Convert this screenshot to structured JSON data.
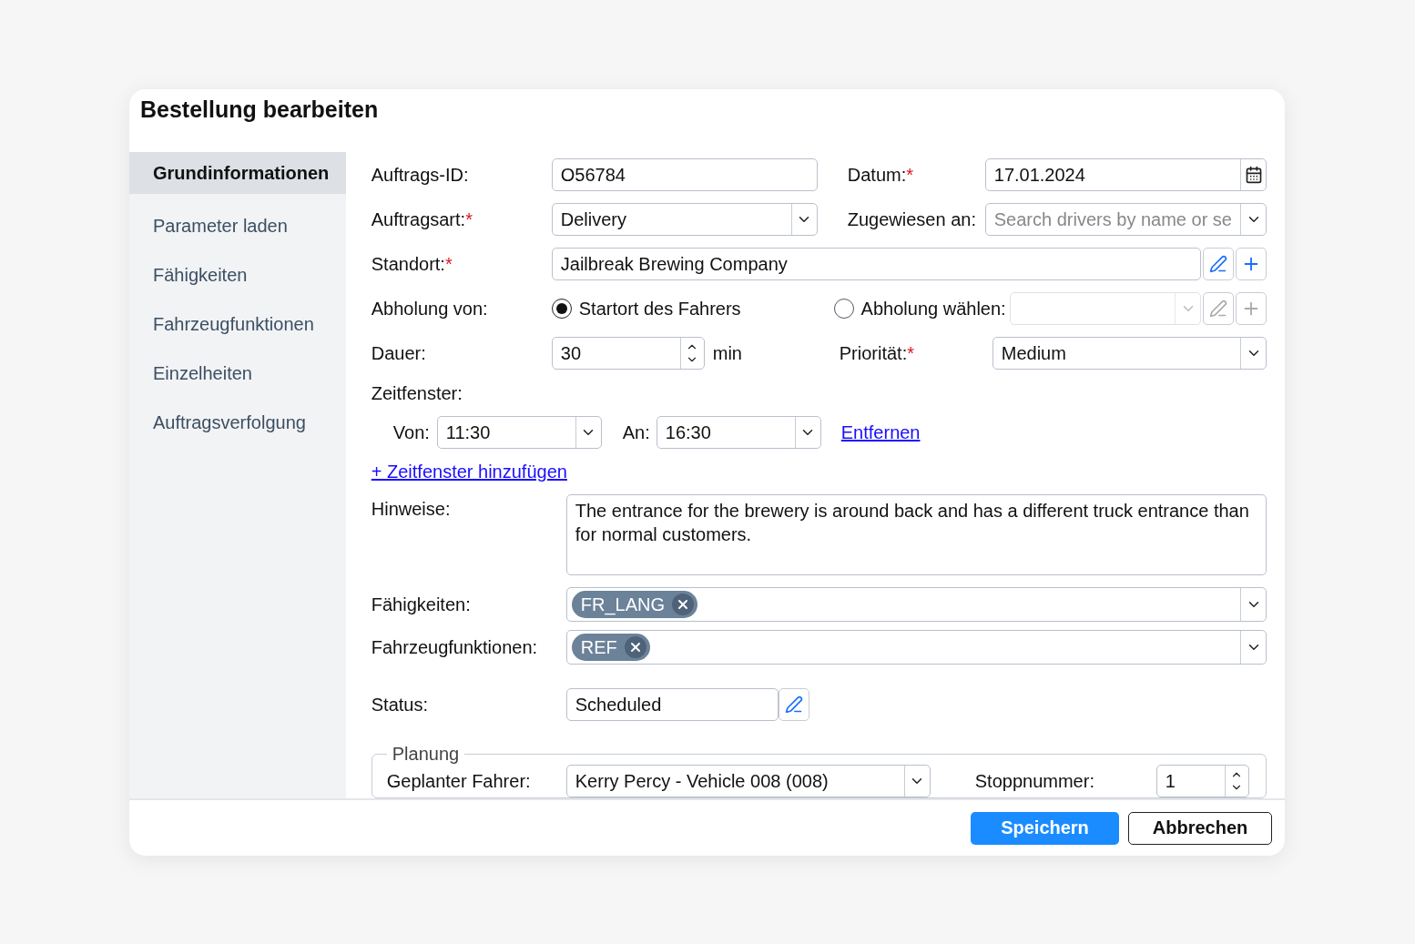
{
  "dialog": {
    "title": "Bestellung bearbeiten"
  },
  "sidebar": {
    "items": [
      {
        "label": "Grundinformationen",
        "selected": true
      },
      {
        "label": "Parameter laden",
        "selected": false
      },
      {
        "label": "Fähigkeiten",
        "selected": false
      },
      {
        "label": "Fahrzeugfunktionen",
        "selected": false
      },
      {
        "label": "Einzelheiten",
        "selected": false
      },
      {
        "label": "Auftragsverfolgung",
        "selected": false
      }
    ]
  },
  "order_id": {
    "label": "Auftrags-ID:",
    "value": "O56784"
  },
  "date": {
    "label": "Datum:",
    "required_mark": "*",
    "value": "17.01.2024"
  },
  "order_type": {
    "label": "Auftragsart:",
    "required_mark": "*",
    "value": "Delivery"
  },
  "assigned_to": {
    "label": "Zugewiesen an:",
    "placeholder": "Search drivers by name or se"
  },
  "location": {
    "label": "Standort:",
    "required_mark": "*",
    "value": "Jailbreak Brewing Company"
  },
  "pickup": {
    "label": "Abholung von:",
    "select_disabled": true,
    "options": [
      {
        "label": "Startort des Fahrers",
        "selected": true
      },
      {
        "label": "Abholung wählen:",
        "selected": false
      }
    ]
  },
  "duration": {
    "label": "Dauer:",
    "value": "30",
    "unit": "min"
  },
  "priority": {
    "label": "Priorität:",
    "required_mark": "*",
    "value": "Medium"
  },
  "time_windows": {
    "label": "Zeitfenster:",
    "windows": [
      {
        "from_label": "Von:",
        "from": "11:30",
        "to_label": "An:",
        "to": "16:30",
        "remove": "Entfernen"
      }
    ],
    "add": "+ Zeitfenster hinzufügen"
  },
  "notes": {
    "label": "Hinweise:",
    "value": "The entrance for the brewery is around back and has a different truck entrance than for normal customers."
  },
  "skills": {
    "label": "Fähigkeiten:",
    "tags": [
      "FR_LANG"
    ]
  },
  "vehicle_features": {
    "label": "Fahrzeugfunktionen:",
    "tags": [
      "REF"
    ]
  },
  "status": {
    "label": "Status:",
    "value": "Scheduled"
  },
  "planning": {
    "legend": "Planung",
    "driver_label": "Geplanter Fahrer:",
    "driver": "Kerry Percy - Vehicle 008 (008)",
    "stop_label": "Stoppnummer:",
    "stop": "1"
  },
  "buttons": [
    {
      "label": "Speichern",
      "kind": "primary"
    },
    {
      "label": "Abbrechen",
      "kind": "secondary"
    }
  ]
}
